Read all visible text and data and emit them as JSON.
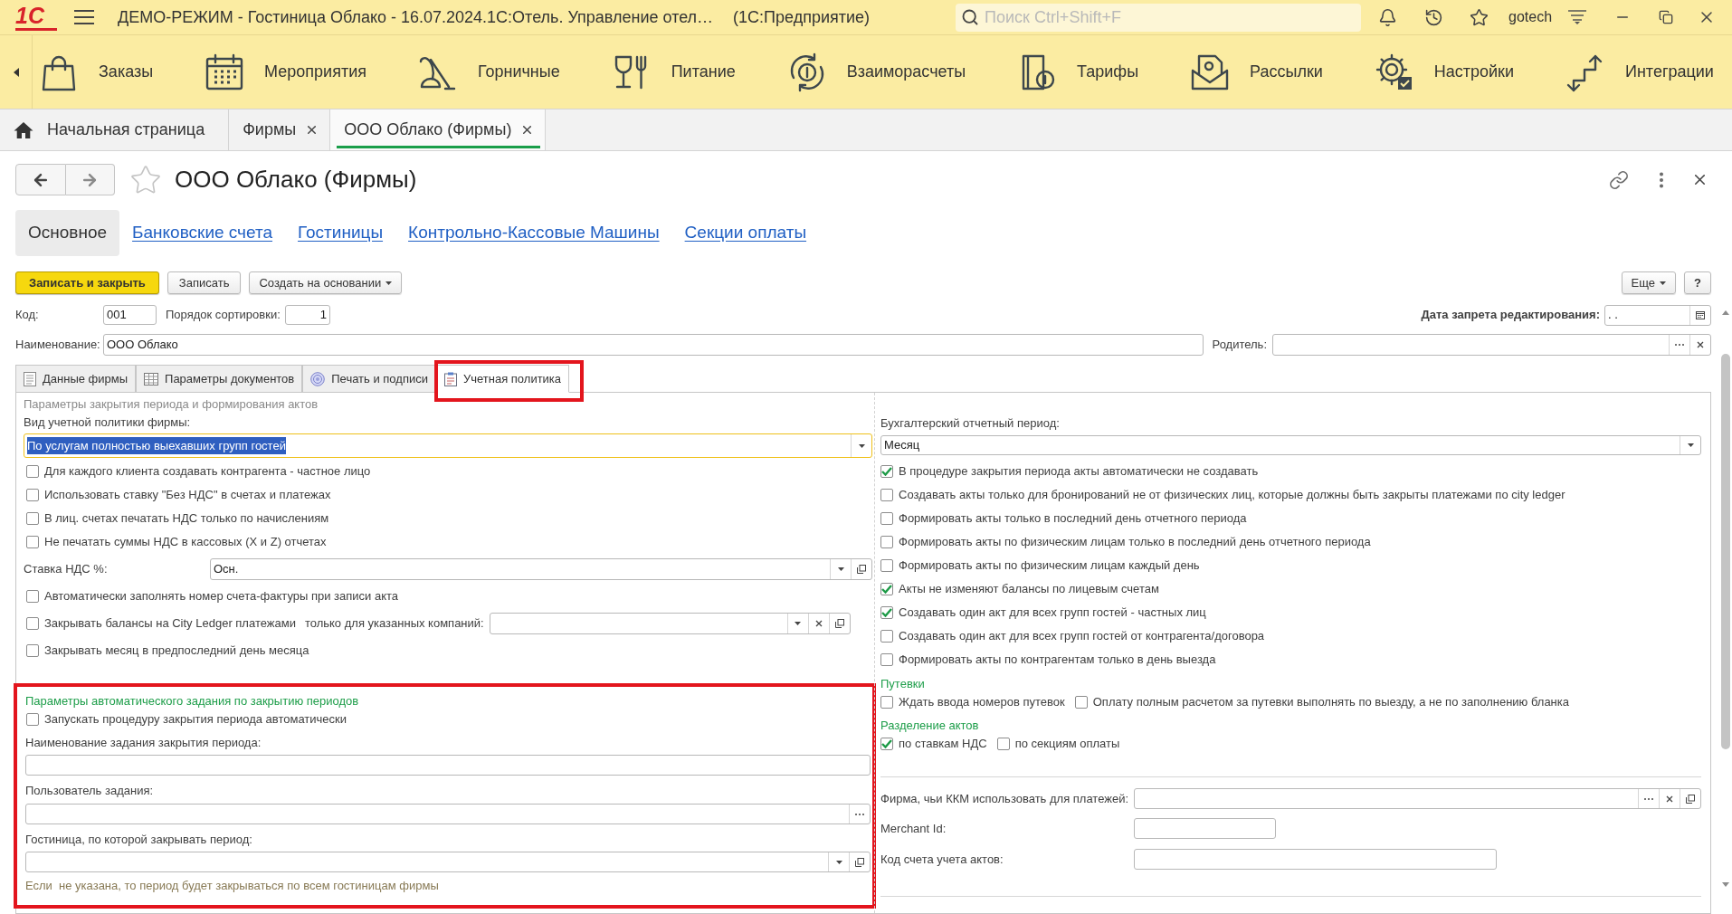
{
  "window": {
    "logo": "1С",
    "title": "ДЕМО-РЕЖИМ - Гостиница Облако - 16.07.2024.1С:Отель. Управление отел…",
    "app": "(1С:Предприятие)",
    "search": {
      "placeholder": "Поиск Ctrl+Shift+F"
    },
    "user": "gotech"
  },
  "sections": [
    {
      "label": "Заказы"
    },
    {
      "label": "Мероприятия"
    },
    {
      "label": "Горничные"
    },
    {
      "label": "Питание"
    },
    {
      "label": "Взаиморасчеты"
    },
    {
      "label": "Тарифы"
    },
    {
      "label": "Рассылки"
    },
    {
      "label": "Настройки"
    },
    {
      "label": "Интеграции"
    }
  ],
  "open_tabs": [
    {
      "label": "Начальная страница",
      "kind": "home",
      "selected": false
    },
    {
      "label": "Фирмы",
      "kind": "closable",
      "selected": false
    },
    {
      "label": "ООО Облако (Фирмы)",
      "kind": "closable",
      "selected": true
    }
  ],
  "form": {
    "title": "ООО Облако (Фирмы)",
    "nav": [
      {
        "label": "Основное",
        "selected": true
      },
      {
        "label": "Банковские счета",
        "selected": false
      },
      {
        "label": "Гостиницы",
        "selected": false
      },
      {
        "label": "Контрольно-Кассовые Машины",
        "selected": false
      },
      {
        "label": "Секции оплаты",
        "selected": false
      }
    ],
    "commands": [
      {
        "label": "Записать и закрыть",
        "kind": "primary"
      },
      {
        "label": "Записать",
        "kind": "plain"
      },
      {
        "label": "Создать на основании",
        "kind": "menu"
      }
    ],
    "extra_commands": [
      {
        "label": "Еще",
        "kind": "menu"
      },
      {
        "label": "?",
        "kind": "help"
      }
    ],
    "code": {
      "label": "Код:",
      "value": "001"
    },
    "sort_order": {
      "label": "Порядок сортировки:",
      "value": "1"
    },
    "edit_lock_date": {
      "label": "Дата запрета редактирования:",
      "value": ". ."
    },
    "name": {
      "label": "Наименование:",
      "value": "ООО Облако"
    },
    "parent": {
      "label": "Родитель:"
    },
    "tabs": [
      {
        "label": "Данные фирмы",
        "selected": false,
        "highlighted": false
      },
      {
        "label": "Параметры документов",
        "selected": false,
        "highlighted": false
      },
      {
        "label": "Печать и подписи",
        "selected": false,
        "highlighted": false
      },
      {
        "label": "Учетная политика",
        "selected": true,
        "highlighted": true
      }
    ]
  },
  "policy": {
    "left": {
      "caption": "Параметры закрытия периода и формирования актов",
      "policy_type": {
        "label": "Вид учетной политики фирмы:",
        "value": "По услугам полностью выехавших групп гостей",
        "focused": true
      },
      "items": [
        {
          "kind": "checkbox",
          "label": "Для каждого клиента создавать контрагента - частное лицо",
          "checked": false
        },
        {
          "kind": "checkbox",
          "label": "Использовать ставку \"Без НДС\" в счетах и платежах",
          "checked": false
        },
        {
          "kind": "checkbox",
          "label": "В лиц. счетах печатать НДС только по начислениям",
          "checked": false
        },
        {
          "kind": "checkbox",
          "label": "Не печатать суммы НДС в кассовых (X и Z) отчетах",
          "checked": false
        },
        {
          "kind": "select",
          "label": "Ставка НДС %:",
          "value": "Осн."
        },
        {
          "kind": "checkbox",
          "label": "Автоматически заполнять номер счета-фактуры при записи акта",
          "checked": false
        },
        {
          "kind": "checkbox_field",
          "label": "Закрывать балансы на City Ledger платежами",
          "field_label": "только для указанных компаний:",
          "checked": false
        },
        {
          "kind": "checkbox",
          "label": "Закрывать месяц в предпоследний день месяца",
          "checked": false
        }
      ]
    },
    "auto_task": {
      "title": "Параметры автоматического задания по закрытию периодов",
      "highlighted": true,
      "run": {
        "label": "Запускать процедуру закрытия периода автоматически",
        "checked": false
      },
      "fields": [
        {
          "kind": "text",
          "label": "Наименование задания закрытия периода:"
        },
        {
          "kind": "choice",
          "label": "Пользователь задания:"
        },
        {
          "kind": "select",
          "label": "Гостиница, по которой закрывать период:"
        }
      ],
      "note": "Если  не указана, то период будет закрываться по всем гостиницам фирмы"
    },
    "right": {
      "period": {
        "label": "Бухгалтерский отчетный период:",
        "value": "Месяц"
      },
      "items": [
        {
          "label": "В процедуре закрытия периода акты автоматически не создавать",
          "checked": true
        },
        {
          "label": "Создавать акты только для бронирований не от физических лиц, которые должны быть закрыты платежами по city ledger",
          "checked": false
        },
        {
          "label": "Формировать акты только в последний день отчетного периода",
          "checked": false
        },
        {
          "label": "Формировать акты по физическим лицам только в последний день отчетного периода",
          "checked": false
        },
        {
          "label": "Формировать акты по физическим лицам каждый день",
          "checked": false
        },
        {
          "label": "Акты не изменяют балансы по лицевым счетам",
          "checked": true
        },
        {
          "label": "Создавать один акт для всех групп гостей - частных лиц",
          "checked": true
        },
        {
          "label": "Создавать один акт для всех групп гостей от контрагента/договора",
          "checked": false
        },
        {
          "label": "Формировать акты по контрагентам только в день выезда",
          "checked": false
        }
      ],
      "groups": [
        {
          "title": "Путевки",
          "items": [
            {
              "label": "Ждать ввода номеров путевок",
              "checked": false
            },
            {
              "label": "Оплату полным расчетом за путевки выполнять по выезду, а не по заполнению бланка",
              "checked": false
            }
          ]
        },
        {
          "title": "Разделение актов",
          "items": [
            {
              "label": "по ставкам НДС",
              "checked": true
            },
            {
              "label": "по секциям оплаты",
              "checked": false
            }
          ]
        }
      ],
      "fields": [
        {
          "kind": "choice",
          "label": "Фирма, чьи ККМ использовать для платежей:"
        },
        {
          "kind": "short",
          "label": "Merchant Id:"
        },
        {
          "kind": "medium",
          "label": "Код счета учета актов:"
        }
      ]
    }
  }
}
